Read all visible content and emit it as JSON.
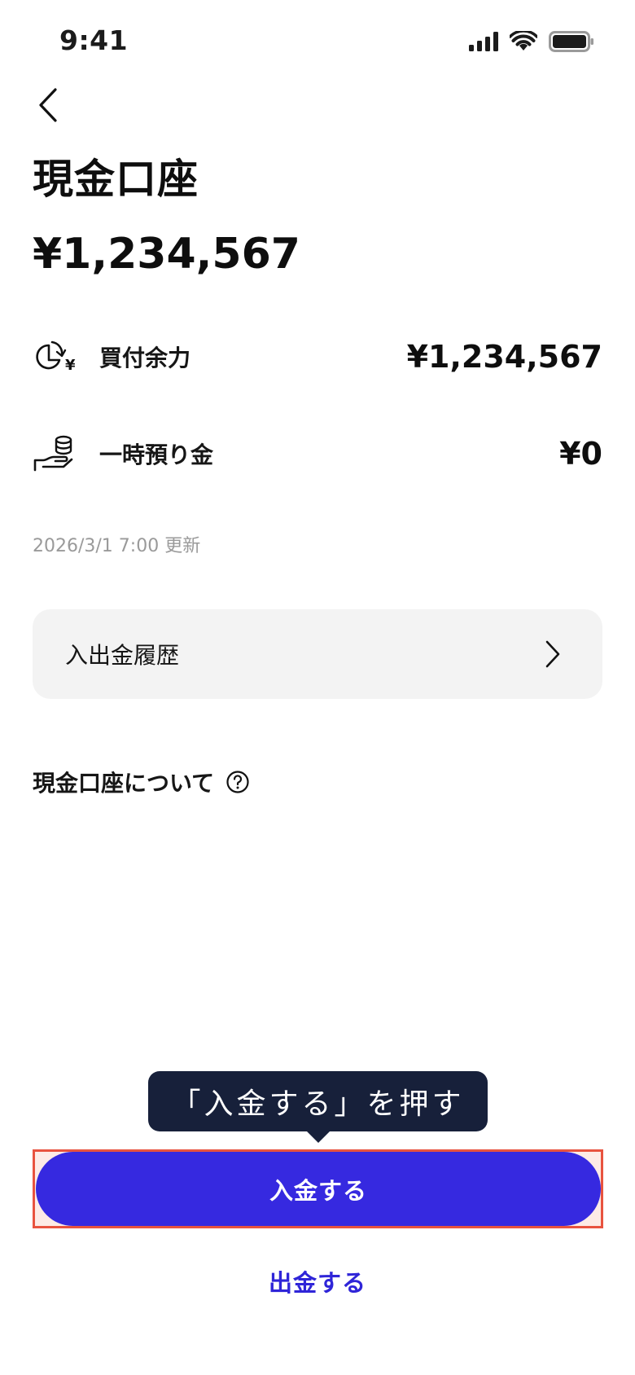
{
  "status_bar": {
    "time": "9:41",
    "icons": [
      "signal-icon",
      "wifi-icon",
      "battery-icon"
    ]
  },
  "header": {
    "back_icon": "chevron-left-icon",
    "title": "現金口座"
  },
  "balance": {
    "total": "¥1,234,567"
  },
  "details": [
    {
      "icon": "buying-power-icon",
      "label": "買付余力",
      "value": "¥1,234,567"
    },
    {
      "icon": "hand-coins-icon",
      "label": "一時預り金",
      "value": "¥0"
    }
  ],
  "updated_at": "2026/3/1 7:00 更新",
  "history": {
    "label": "入出金履歴",
    "icon": "chevron-right-icon"
  },
  "about": {
    "label": "現金口座について",
    "icon": "help-circle-icon"
  },
  "tooltip": {
    "text": "「入金する」を押す"
  },
  "actions": {
    "deposit_label": "入金する",
    "withdraw_label": "出金する"
  },
  "colors": {
    "primary": "#3629e0",
    "tooltip_bg": "#17203a",
    "highlight_border": "#e8533f",
    "card_bg": "#f3f3f3"
  }
}
